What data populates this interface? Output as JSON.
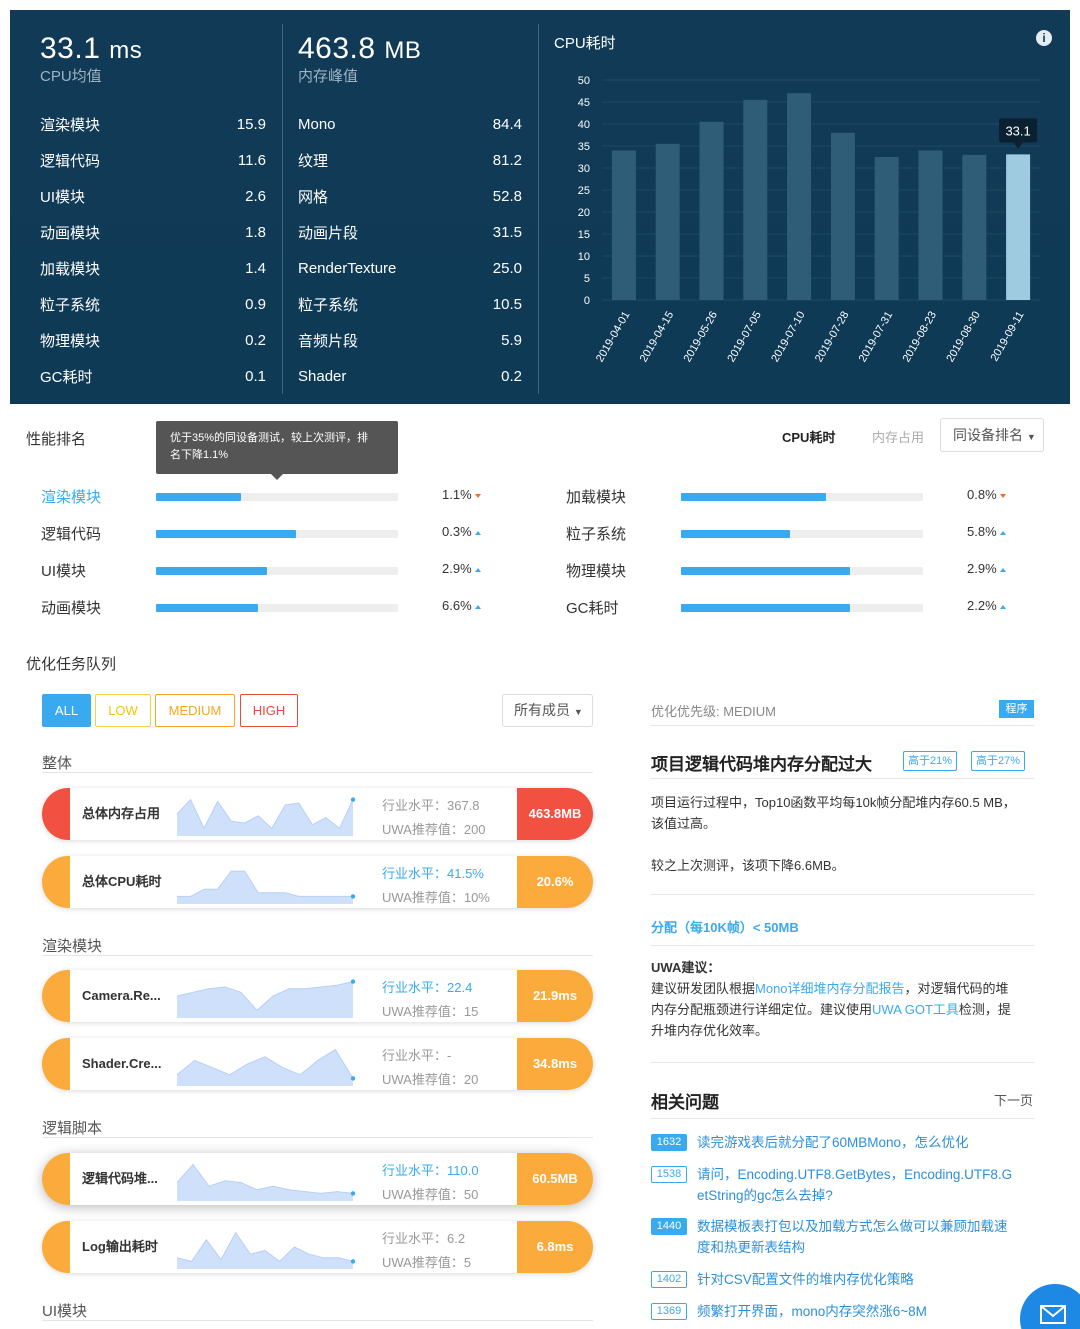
{
  "cpu": {
    "value": "33.1",
    "unit": "ms",
    "label": "CPU均值",
    "rows": [
      {
        "name": "渲染模块",
        "value": "15.9"
      },
      {
        "name": "逻辑代码",
        "value": "11.6"
      },
      {
        "name": "UI模块",
        "value": "2.6"
      },
      {
        "name": "动画模块",
        "value": "1.8"
      },
      {
        "name": "加载模块",
        "value": "1.4"
      },
      {
        "name": "粒子系统",
        "value": "0.9"
      },
      {
        "name": "物理模块",
        "value": "0.2"
      },
      {
        "name": "GC耗时",
        "value": "0.1"
      }
    ]
  },
  "memory": {
    "value": "463.8",
    "unit": "MB",
    "label": "内存峰值",
    "rows": [
      {
        "name": "Mono",
        "value": "84.4"
      },
      {
        "name": "纹理",
        "value": "81.2"
      },
      {
        "name": "网格",
        "value": "52.8"
      },
      {
        "name": "动画片段",
        "value": "31.5"
      },
      {
        "name": "RenderTexture",
        "value": "25.0"
      },
      {
        "name": "粒子系统",
        "value": "10.5"
      },
      {
        "name": "音频片段",
        "value": "5.9"
      },
      {
        "name": "Shader",
        "value": "0.2"
      }
    ]
  },
  "chart_data": {
    "type": "bar",
    "title": "CPU耗时",
    "categories": [
      "2019-04-01",
      "2019-04-15",
      "2019-05-26",
      "2019-07-05",
      "2019-07-10",
      "2019-07-28",
      "2019-07-31",
      "2019-08-23",
      "2019-08-30",
      "2019-09-11"
    ],
    "values": [
      34,
      35.5,
      40.5,
      45.5,
      47,
      38,
      32.5,
      34,
      33,
      33.1
    ],
    "highlight_index": 9,
    "highlight_label": "33.1",
    "ylim": [
      0,
      50
    ],
    "yticks": [
      "0",
      "5",
      "10",
      "15",
      "20",
      "25",
      "30",
      "35",
      "40",
      "45",
      "50"
    ],
    "colors": {
      "bar": "#2f5d77",
      "highlight": "#9ecbe0"
    }
  },
  "ranking": {
    "title": "性能排名",
    "tooltip_line1": "优于35%的同设备测试，较上次测评，排",
    "tooltip_line2": "名下降1.1%",
    "tabs": [
      "CPU耗时",
      "内存占用"
    ],
    "dropdown": "同设备排名",
    "rows": [
      {
        "name": "渲染模块",
        "fill": 0.35,
        "pct": "1.1%",
        "dir": "down",
        "active": true
      },
      {
        "name": "逻辑代码",
        "fill": 0.58,
        "pct": "0.3%",
        "dir": "up"
      },
      {
        "name": "UI模块",
        "fill": 0.46,
        "pct": "2.9%",
        "dir": "up"
      },
      {
        "name": "动画模块",
        "fill": 0.42,
        "pct": "6.6%",
        "dir": "up"
      },
      {
        "name": "加载模块",
        "fill": 0.6,
        "pct": "0.8%",
        "dir": "down"
      },
      {
        "name": "粒子系统",
        "fill": 0.45,
        "pct": "5.8%",
        "dir": "up"
      },
      {
        "name": "物理模块",
        "fill": 0.7,
        "pct": "2.9%",
        "dir": "up"
      },
      {
        "name": "GC耗时",
        "fill": 0.7,
        "pct": "2.2%",
        "dir": "up"
      }
    ]
  },
  "queue": {
    "title": "优化任务队列",
    "filters": [
      "ALL",
      "LOW",
      "MEDIUM",
      "HIGH"
    ],
    "member": "所有成员",
    "sections": [
      "整体",
      "渲染模块",
      "逻辑脚本",
      "UI模块"
    ],
    "cards": [
      {
        "name": "总体内存占用",
        "b1": "行业水平：367.8",
        "b2": "UWA推荐值：200",
        "val": "463.8MB",
        "level": "high",
        "blue": false,
        "spark": [
          0.5,
          0.1,
          0.9,
          0.15,
          0.7,
          0.75,
          0.55,
          0.9,
          0.25,
          0.2,
          0.8,
          0.6,
          0.9,
          0.1
        ]
      },
      {
        "name": "总体CPU耗时",
        "b1": "行业水平：41.5%",
        "b2": "UWA推荐值：10%",
        "val": "20.6%",
        "level": "med",
        "blue": true,
        "spark": [
          0.9,
          0.9,
          0.7,
          0.7,
          0.2,
          0.2,
          0.8,
          0.8,
          0.8,
          0.9,
          0.9,
          0.9,
          0.9,
          0.9
        ]
      },
      {
        "name": "Camera.Re...",
        "b1": "行业水平：22.4",
        "b2": "UWA推荐值：15",
        "val": "21.9ms",
        "level": "med",
        "blue": true,
        "spark": [
          0.5,
          0.4,
          0.3,
          0.25,
          0.4,
          0.9,
          0.5,
          0.3,
          0.3,
          0.25,
          0.2,
          0.1
        ]
      },
      {
        "name": "Shader.Cre...",
        "b1": "行业水平：-",
        "b2": "UWA推荐值：20",
        "val": "34.8ms",
        "level": "med",
        "blue": false,
        "spark": [
          0.8,
          0.4,
          0.6,
          0.8,
          0.5,
          0.3,
          0.6,
          0.8,
          0.4,
          0.1,
          0.9
        ]
      },
      {
        "name": "逻辑代码堆...",
        "b1": "行业水平：110.0",
        "b2": "UWA推荐值：50",
        "val": "60.5MB",
        "level": "med",
        "blue": true,
        "hl": true,
        "spark": [
          0.6,
          0.1,
          0.7,
          0.55,
          0.6,
          0.8,
          0.7,
          0.8,
          0.85,
          0.9,
          0.85,
          0.9
        ]
      },
      {
        "name": "Log输出耗时",
        "b1": "行业水平：6.2",
        "b2": "UWA推荐值：5",
        "val": "6.8ms",
        "level": "med",
        "blue": false,
        "spark": [
          0.8,
          0.9,
          0.3,
          0.85,
          0.1,
          0.7,
          0.6,
          0.9,
          0.5,
          0.7,
          0.8,
          0.8,
          0.9
        ]
      }
    ]
  },
  "detail": {
    "priority": "优化优先级: MEDIUM",
    "badge": "程序",
    "title": "项目逻辑代码堆内存分配过大",
    "tags": [
      "高于21%",
      "高于27%"
    ],
    "desc1": "项目运行过程中，Top10函数平均每10k帧分配堆内存60.5 MB，",
    "desc2": "该值过高。",
    "compare": "较之上次测评，该项下降6.6MB。",
    "metric": "分配（每10K帧）< 50MB",
    "advice_title": "UWA建议：",
    "advice_a": "建议研发团队根据",
    "advice_link1": "Mono详细堆内存分配报告",
    "advice_b": "，对逻辑代码的堆",
    "advice_c": "内存分配瓶颈进行详细定位。建议使用",
    "advice_link2": "UWA GOT工具",
    "advice_d": "检测，提",
    "advice_e": "升堆内存优化效率。",
    "related_title": "相关问题",
    "next": "下一页",
    "questions": [
      {
        "id": "1632",
        "l1": "读完游戏表后就分配了60MBMono，怎么优化",
        "l2": "",
        "solid": true
      },
      {
        "id": "1538",
        "l1": "请问，Encoding.UTF8.GetBytes，Encoding.UTF8.G",
        "l2": "etString的gc怎么去掉?",
        "solid": false
      },
      {
        "id": "1440",
        "l1": "数据模板表打包以及加载方式怎么做可以兼顾加载速",
        "l2": "度和热更新表结构",
        "solid": true
      },
      {
        "id": "1402",
        "l1": "针对CSV配置文件的堆内存优化策略",
        "l2": "",
        "solid": false
      },
      {
        "id": "1369",
        "l1": "频繁打开界面，mono内存突然涨6~8M",
        "l2": "",
        "solid": false
      }
    ]
  }
}
